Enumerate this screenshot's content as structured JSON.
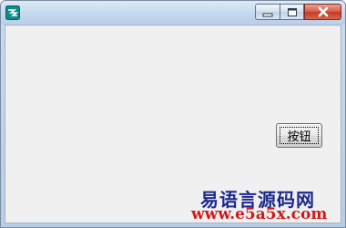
{
  "window": {
    "title": "",
    "buttons": {
      "minimize_icon": "minimize-icon",
      "maximize_icon": "maximize-icon",
      "close_icon": "close-icon"
    }
  },
  "form": {
    "button_label": "按钮"
  },
  "watermark": {
    "line1": "易语言源码网",
    "line2": "www.e5a5x.com"
  },
  "colors": {
    "close_button": "#c43b26",
    "watermark_blue": "#1c2a8e",
    "watermark_red": "#d11a1a",
    "client_bg": "#f0f0f0"
  }
}
